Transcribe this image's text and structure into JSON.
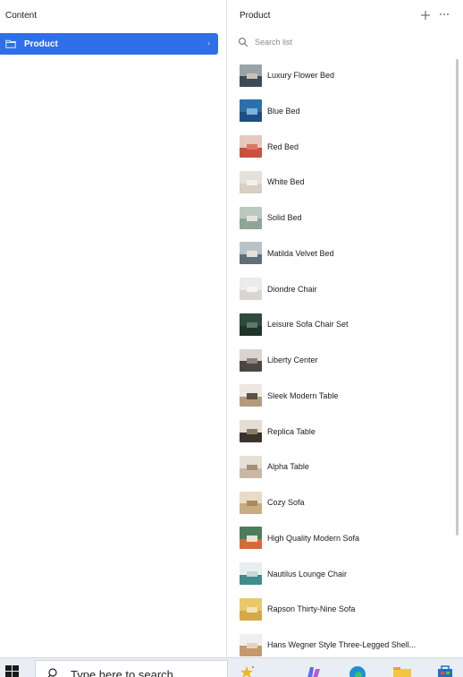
{
  "left": {
    "title": "Content",
    "nav_item": {
      "label": "Product",
      "icon": "folder-icon",
      "chevron": "›"
    }
  },
  "right": {
    "title": "Product",
    "add_icon": "plus-icon",
    "more_icon": "ellipsis-icon",
    "search": {
      "placeholder": "Search list",
      "value": ""
    },
    "items": [
      {
        "name": "Luxury Flower Bed",
        "colors": [
          "#9aa4a8",
          "#3e4b55",
          "#c9c2b6"
        ]
      },
      {
        "name": "Blue Bed",
        "colors": [
          "#2d6fa8",
          "#1d4f84",
          "#7fb2dc"
        ]
      },
      {
        "name": "Red Bed",
        "colors": [
          "#e7c8bd",
          "#c9523e",
          "#e0765f"
        ]
      },
      {
        "name": "White Bed",
        "colors": [
          "#e6e1d8",
          "#d6cfc2",
          "#f3f0ea"
        ]
      },
      {
        "name": "Solid Bed",
        "colors": [
          "#b9c9c0",
          "#8fa597",
          "#e8e4dc"
        ]
      },
      {
        "name": "Matilda Velvet Bed",
        "colors": [
          "#b8c3c8",
          "#5f6f7a",
          "#e4e0d9"
        ]
      },
      {
        "name": "Diondre Chair",
        "colors": [
          "#ecebea",
          "#d9d6d2",
          "#f6f5f3"
        ]
      },
      {
        "name": "Leisure Sofa Chair Set",
        "colors": [
          "#2f4a3c",
          "#1f3329",
          "#5a7a66"
        ]
      },
      {
        "name": "Liberty Center",
        "colors": [
          "#d9d4ce",
          "#4a4744",
          "#8b8580"
        ]
      },
      {
        "name": "Sleek Modern Table",
        "colors": [
          "#ece7e0",
          "#b39a7d",
          "#5c5046"
        ]
      },
      {
        "name": "Replica Table",
        "colors": [
          "#e3ddd4",
          "#3a332d",
          "#8c7a66"
        ]
      },
      {
        "name": "Alpha Table",
        "colors": [
          "#e5dfd6",
          "#c7b9a6",
          "#a58f77"
        ]
      },
      {
        "name": "Cozy Sofa",
        "colors": [
          "#e8dcc6",
          "#c9ad7f",
          "#a88a5c"
        ]
      },
      {
        "name": "High Quality Modern Sofa",
        "colors": [
          "#4c7d5a",
          "#d46a3a",
          "#e8e1d5"
        ]
      },
      {
        "name": "Nautilus Lounge Chair",
        "colors": [
          "#e9eeee",
          "#3e8c8e",
          "#c9d6d6"
        ]
      },
      {
        "name": "Rapson Thirty-Nine Sofa",
        "colors": [
          "#e9c86b",
          "#d6a944",
          "#f1e2b8"
        ]
      },
      {
        "name": "Hans Wegner Style Three-Legged Shell...",
        "colors": [
          "#efefef",
          "#c49a6c",
          "#e6d3bd"
        ]
      }
    ]
  },
  "taskbar": {
    "search_text": "Type here to search",
    "icons": [
      "windows-start-icon",
      "search-icon",
      "copilot-icon",
      "edge-icon",
      "file-explorer-icon",
      "store-icon"
    ]
  }
}
